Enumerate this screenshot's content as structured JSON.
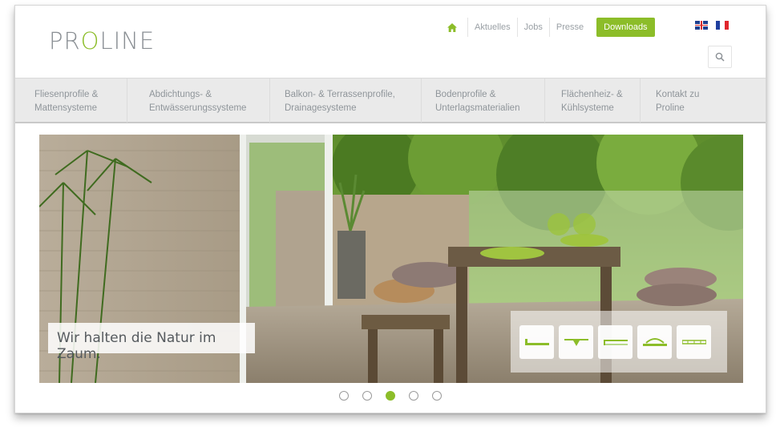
{
  "brand": {
    "logo_prefix": "PR",
    "logo_accent": "O",
    "logo_suffix": "LINE",
    "accent_color": "#8cbd29"
  },
  "topnav": {
    "home_icon": "home-icon",
    "links": [
      "Aktuelles",
      "Jobs",
      "Presse"
    ],
    "downloads_label": "Downloads",
    "languages": [
      "en",
      "fr"
    ],
    "search_icon": "search-icon"
  },
  "mainnav": {
    "items": [
      "Fliesenprofile &\nMattensysteme",
      "Abdichtungs- &\nEntwässerungssysteme",
      "Balkon- & Terrassenprofile,\nDrainagesysteme",
      "Bodenprofile &\nUnterlagsmaterialien",
      "Flächenheiz- &\nKühlsysteme",
      "Kontakt zu\nProline"
    ]
  },
  "hero": {
    "caption": "Wir halten die Natur im Zaum.",
    "product_icons": [
      "tile-profile-icon",
      "drain-profile-icon",
      "floor-profile-icon",
      "heating-profile-icon",
      "mat-profile-icon"
    ]
  },
  "slider": {
    "total": 5,
    "active_index": 2
  }
}
